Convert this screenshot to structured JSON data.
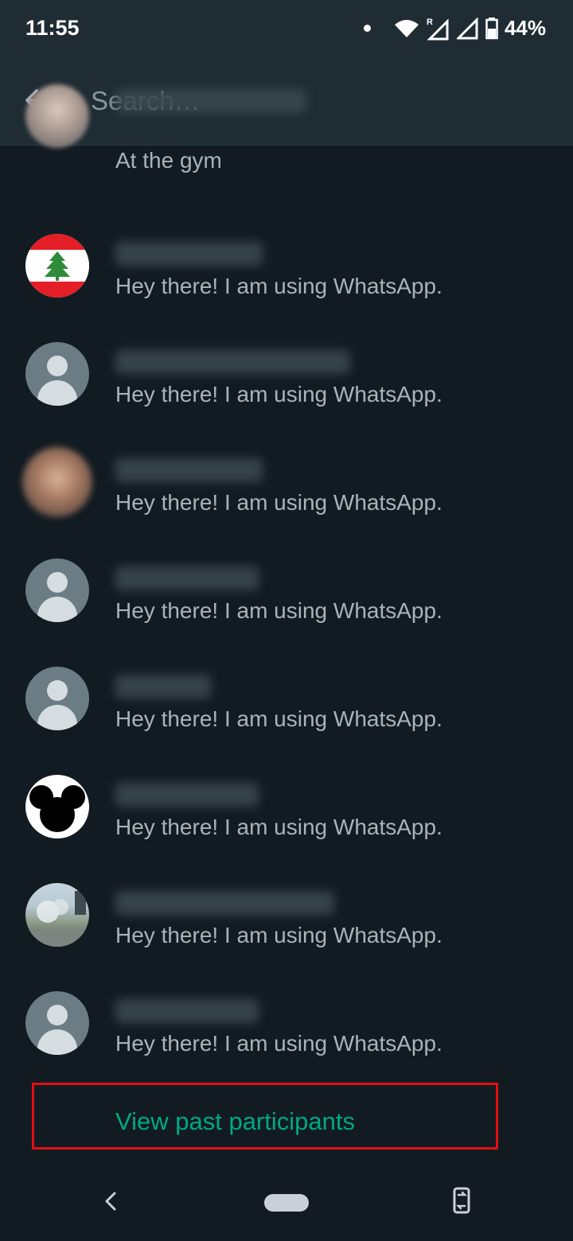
{
  "status_bar": {
    "time": "11:55",
    "battery": "44%",
    "icons": [
      "notification-dot-icon",
      "wifi-icon",
      "roaming-signal-icon",
      "signal-icon",
      "battery-icon"
    ]
  },
  "app_bar": {
    "search_placeholder": "Search…",
    "back_icon": "arrow-left-icon"
  },
  "participants": [
    {
      "status": "At the gym",
      "avatar": "photo-person"
    },
    {
      "status": "Hey there! I am using WhatsApp.",
      "avatar": "lebanon-flag"
    },
    {
      "status": "Hey there! I am using WhatsApp.",
      "avatar": "default-person"
    },
    {
      "status": "Hey there! I am using WhatsApp.",
      "avatar": "photo-person"
    },
    {
      "status": "Hey there! I am using WhatsApp.",
      "avatar": "default-person"
    },
    {
      "status": "Hey there! I am using WhatsApp.",
      "avatar": "default-person"
    },
    {
      "status": "Hey there! I am using WhatsApp.",
      "avatar": "mouse-ears"
    },
    {
      "status": "Hey there! I am using WhatsApp.",
      "avatar": "photo-trees"
    },
    {
      "status": "Hey there! I am using WhatsApp.",
      "avatar": "default-person"
    }
  ],
  "view_past": {
    "label": "View past participants"
  },
  "colors": {
    "accent": "#00a884",
    "background": "#121b22",
    "bar": "#1f2c34",
    "highlight_border": "#e31010"
  }
}
